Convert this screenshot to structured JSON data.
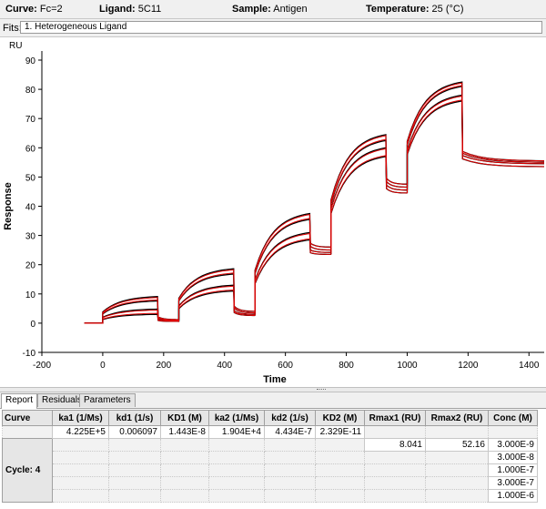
{
  "header": {
    "curve_label": "Curve:",
    "curve_value": "Fc=2",
    "ligand_label": "Ligand:",
    "ligand_value": "5C11",
    "sample_label": "Sample:",
    "sample_value": "Antigen",
    "temperature_label": "Temperature:",
    "temperature_value": "25 (°C)"
  },
  "fits": {
    "label": "Fits:",
    "selected": "1. Heterogeneous Ligand"
  },
  "chart_data": {
    "type": "line",
    "unit_label": "RU",
    "ylabel": "Response",
    "xlabel": "Time",
    "xlim": [
      -200,
      1450
    ],
    "ylim": [
      -10,
      90
    ],
    "x_ticks": [
      "-200",
      "0",
      "200",
      "400",
      "600",
      "800",
      "1000",
      "1200",
      "1400"
    ],
    "y_ticks": [
      "-10",
      "0",
      "10",
      "20",
      "30",
      "40",
      "50",
      "60",
      "70",
      "80",
      "90"
    ],
    "grid": false,
    "series_colors": {
      "measured": "#000000",
      "fitted": "#e00000"
    },
    "injections": [
      {
        "start": 0,
        "stop": 180,
        "concentration": "3.000E-9",
        "assoc_end": [
          9.1,
          7.6,
          4.8,
          3.0
        ],
        "dissoc_end": [
          1.2,
          1.0,
          0.8,
          0.6
        ]
      },
      {
        "start": 250,
        "stop": 430,
        "concentration": "3.000E-8",
        "assoc_end": [
          18.6,
          16.8,
          13.0,
          11.0
        ],
        "dissoc_end": [
          4.0,
          3.5,
          3.0,
          2.6
        ]
      },
      {
        "start": 500,
        "stop": 680,
        "concentration": "1.000E-7",
        "assoc_end": [
          37.5,
          35.5,
          31.0,
          28.5
        ],
        "dissoc_end": [
          26.0,
          25.0,
          24.2,
          23.5
        ]
      },
      {
        "start": 750,
        "stop": 930,
        "concentration": "3.000E-7",
        "assoc_end": [
          64.5,
          62.5,
          60.0,
          57.0
        ],
        "dissoc_end": [
          47.5,
          46.5,
          45.5,
          44.5
        ]
      },
      {
        "start": 1000,
        "stop": 1180,
        "concentration": "1.000E-6",
        "assoc_end": [
          82.5,
          81.0,
          78.0,
          76.0
        ],
        "dissoc_end": [
          55.5,
          55.0,
          54.5,
          53.5
        ]
      }
    ],
    "baseline": {
      "start": -60,
      "value": 0
    }
  },
  "tabs": [
    "Report",
    "Residuals",
    "Parameters"
  ],
  "active_tab": "Report",
  "report": {
    "columns": [
      "Curve",
      "ka1 (1/Ms)",
      "kd1 (1/s)",
      "KD1 (M)",
      "ka2 (1/Ms)",
      "kd2 (1/s)",
      "KD2 (M)",
      "Rmax1 (RU)",
      "Rmax2 (RU)",
      "Conc (M)"
    ],
    "global_row": [
      "",
      "4.225E+5",
      "0.006097",
      "1.443E-8",
      "1.904E+4",
      "4.434E-7",
      "2.329E-11",
      "",
      "",
      ""
    ],
    "cycle_label": "Cycle: 4",
    "rmax1": "8.041",
    "rmax2": "52.16",
    "concentrations": [
      "3.000E-9",
      "3.000E-8",
      "1.000E-7",
      "3.000E-7",
      "1.000E-6"
    ]
  }
}
